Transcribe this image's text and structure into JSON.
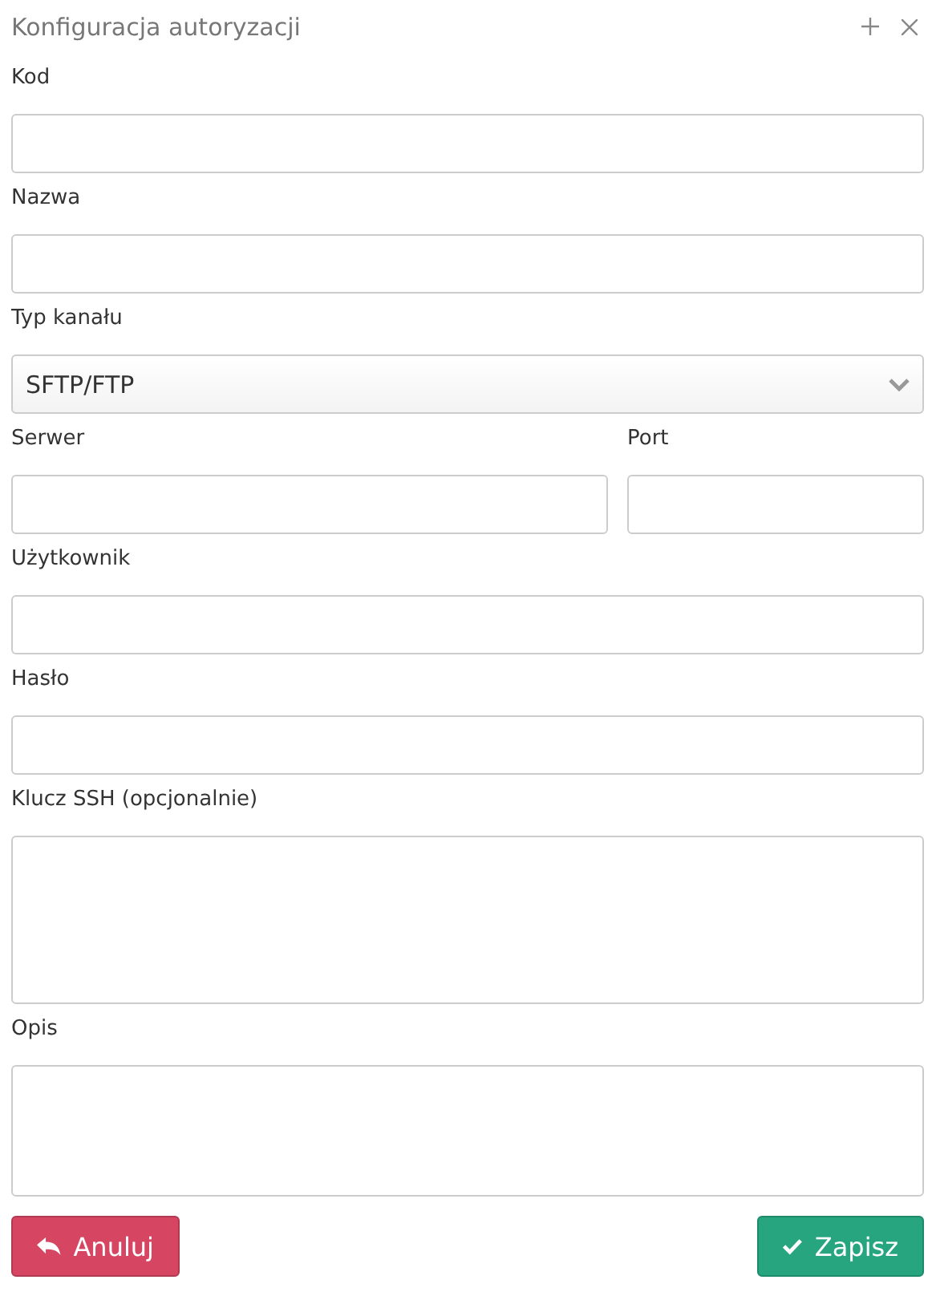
{
  "window": {
    "title": "Konfiguracja autoryzacji"
  },
  "rows": [
    {
      "fields": [
        {
          "label": "Kod",
          "kind": "input"
        }
      ]
    },
    {
      "fields": [
        {
          "label": "Nazwa",
          "kind": "input"
        }
      ]
    },
    {
      "fields": [
        {
          "label": "Typ kanału",
          "kind": "select",
          "value": "SFTP/FTP"
        }
      ]
    },
    {
      "fields": [
        {
          "label": "Serwer",
          "kind": "input"
        },
        {
          "label": "Port",
          "kind": "input"
        }
      ]
    },
    {
      "fields": [
        {
          "label": "Użytkownik",
          "kind": "input"
        }
      ]
    },
    {
      "fields": [
        {
          "label": "Hasło",
          "kind": "input"
        }
      ]
    },
    {
      "fields": [
        {
          "label": "Klucz SSH (opcjonalnie)",
          "kind": "textarea"
        }
      ]
    },
    {
      "fields": [
        {
          "label": "Opis",
          "kind": "textarea"
        }
      ]
    }
  ],
  "buttons": [
    {
      "label": "Anuluj",
      "kind": "cancel"
    },
    {
      "label": "Zapisz",
      "kind": "save"
    }
  ]
}
